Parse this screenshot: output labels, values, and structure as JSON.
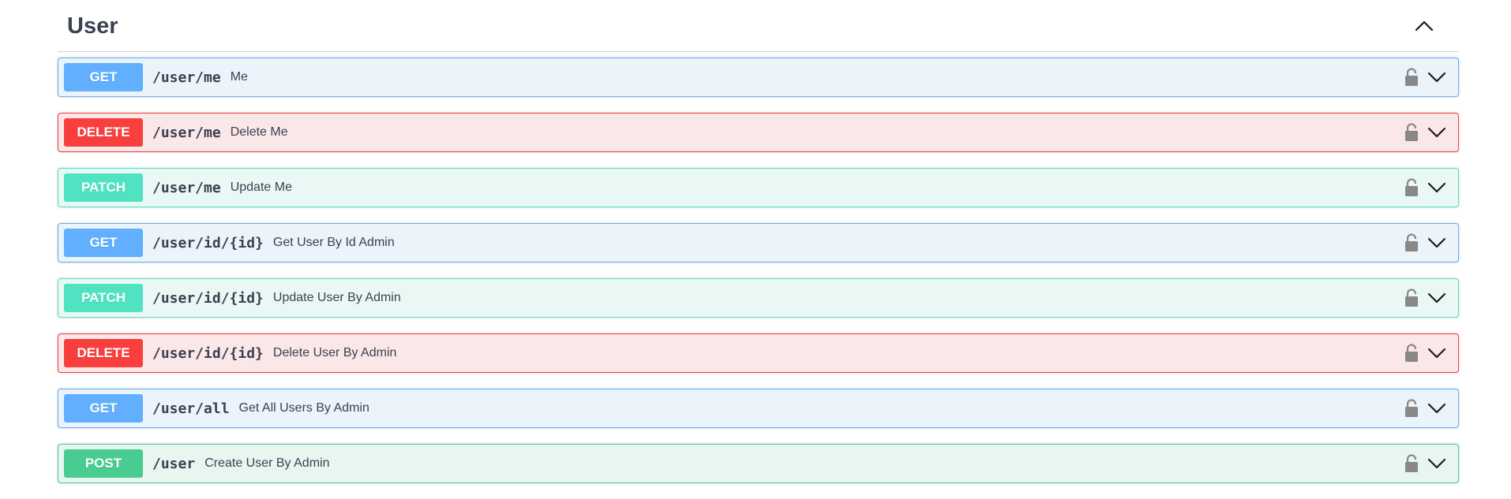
{
  "section": {
    "title": "User",
    "expanded": true
  },
  "colors": {
    "get": "#61affe",
    "delete": "#f93e3e",
    "patch": "#50e3c2",
    "post": "#49cc90"
  },
  "operations": [
    {
      "method": "GET",
      "path": "/user/me",
      "summary": "Me",
      "locked": true
    },
    {
      "method": "DELETE",
      "path": "/user/me",
      "summary": "Delete Me",
      "locked": true
    },
    {
      "method": "PATCH",
      "path": "/user/me",
      "summary": "Update Me",
      "locked": true
    },
    {
      "method": "GET",
      "path": "/user/id/{id}",
      "summary": "Get User By Id Admin",
      "locked": true
    },
    {
      "method": "PATCH",
      "path": "/user/id/{id}",
      "summary": "Update User By Admin",
      "locked": true
    },
    {
      "method": "DELETE",
      "path": "/user/id/{id}",
      "summary": "Delete User By Admin",
      "locked": true
    },
    {
      "method": "GET",
      "path": "/user/all",
      "summary": "Get All Users By Admin",
      "locked": true
    },
    {
      "method": "POST",
      "path": "/user",
      "summary": "Create User By Admin",
      "locked": true
    }
  ],
  "icons": {
    "collapse": "chevron-up-icon",
    "lock": "lock-icon",
    "expand": "chevron-down-icon"
  }
}
